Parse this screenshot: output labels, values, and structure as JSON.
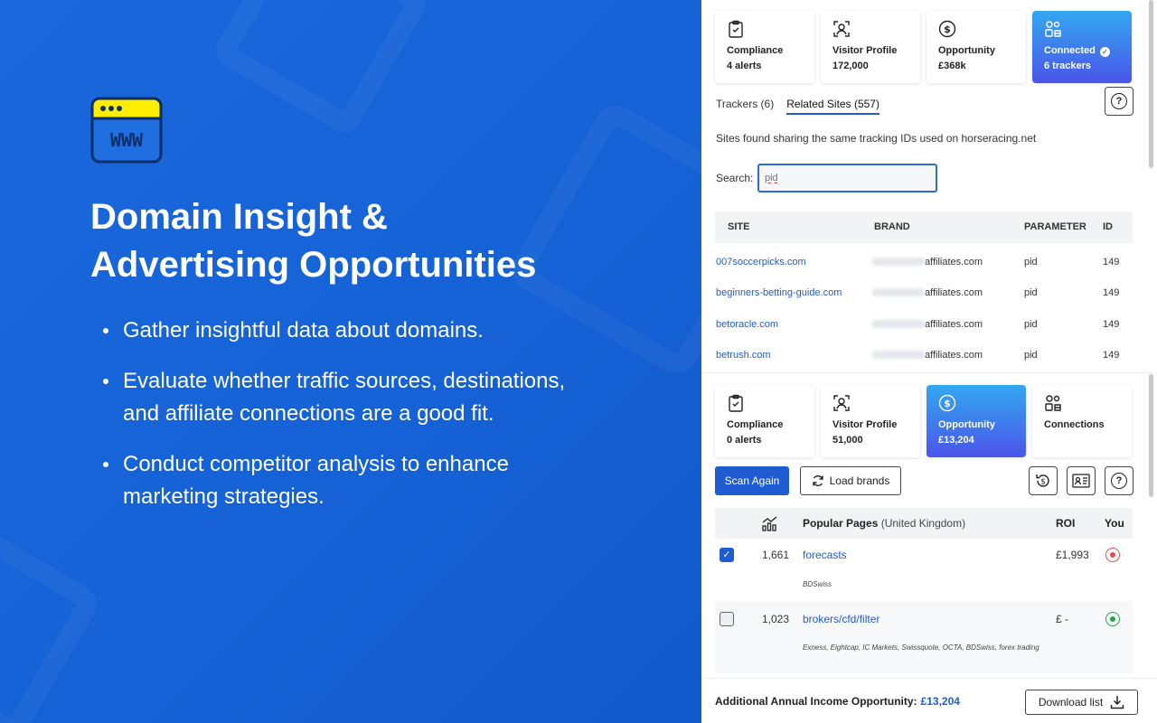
{
  "hero": {
    "title_line1": "Domain Insight &",
    "title_line2": "Advertising Opportunities",
    "bullets": [
      "Gather insightful data about domains.",
      "Evaluate whether traffic sources, destinations, and affiliate connections are a good fit.",
      "Conduct competitor analysis to enhance marketing strategies."
    ],
    "logo_text": "WWW"
  },
  "colors": {
    "accent": "#1f5bd1",
    "hero_bg": "#1565d8",
    "card_gradient_top": "#33a8f0",
    "card_gradient_bottom": "#4a55ea",
    "logo_yellow": "#ffee00"
  },
  "top_cards": [
    {
      "icon": "clipboard-check-icon",
      "label": "Compliance",
      "value": "4 alerts"
    },
    {
      "icon": "visitor-profile-icon",
      "label": "Visitor Profile",
      "value": "172,000"
    },
    {
      "icon": "dollar-circle-icon",
      "label": "Opportunity",
      "value": "£368k"
    },
    {
      "icon": "connections-icon",
      "label": "Connected",
      "value": "6 trackers",
      "check": "✓"
    }
  ],
  "tabs": {
    "trackers": "Trackers (6)",
    "related": "Related Sites (557)",
    "help": "?"
  },
  "related": {
    "description": "Sites found sharing the same tracking IDs used on horseracing.net",
    "search_label": "Search:",
    "search_value": "pid",
    "columns": {
      "site": "SITE",
      "brand": "BRAND",
      "parameter": "PARAMETER",
      "id": "ID"
    },
    "rows": [
      {
        "site": "007soccerpicks.com",
        "brand": "affiliates.com",
        "parameter": "pid",
        "id": "149"
      },
      {
        "site": "beginners-betting-guide.com",
        "brand": "affiliates.com",
        "parameter": "pid",
        "id": "149"
      },
      {
        "site": "betoracle.com",
        "brand": "affiliates.com",
        "parameter": "pid",
        "id": "149"
      },
      {
        "site": "betrush.com",
        "brand": "affiliates.com",
        "parameter": "pid",
        "id": "149"
      }
    ]
  },
  "bottom_cards": [
    {
      "icon": "clipboard-check-icon",
      "label": "Compliance",
      "value": "0 alerts"
    },
    {
      "icon": "visitor-profile-icon",
      "label": "Visitor Profile",
      "value": "51,000"
    },
    {
      "icon": "dollar-circle-icon",
      "label": "Opportunity",
      "value": "£13,204"
    },
    {
      "icon": "connections-icon",
      "label": "Connections",
      "value": ""
    }
  ],
  "actions": {
    "scan": "Scan Again",
    "load_brands": "Load brands",
    "help": "?"
  },
  "popular": {
    "title": "Popular Pages",
    "region": "(United Kingdom)",
    "roi_header": "ROI",
    "you_header": "You",
    "rows": [
      {
        "checked": true,
        "check": "✓",
        "count": "1,661",
        "page": "forecasts",
        "brands": "BDSwiss",
        "roi": "£1,993",
        "status": "red"
      },
      {
        "checked": false,
        "count": "1,023",
        "page": "brokers/cfd/filter",
        "brands": "Exness, Eightcap, IC Markets, Swissquote, OCTA, BDSwiss, forex trading",
        "roi": "£ -",
        "status": "green"
      }
    ]
  },
  "footer": {
    "label": "Additional Annual Income Opportunity:",
    "value": "£13,204",
    "download": "Download list"
  }
}
